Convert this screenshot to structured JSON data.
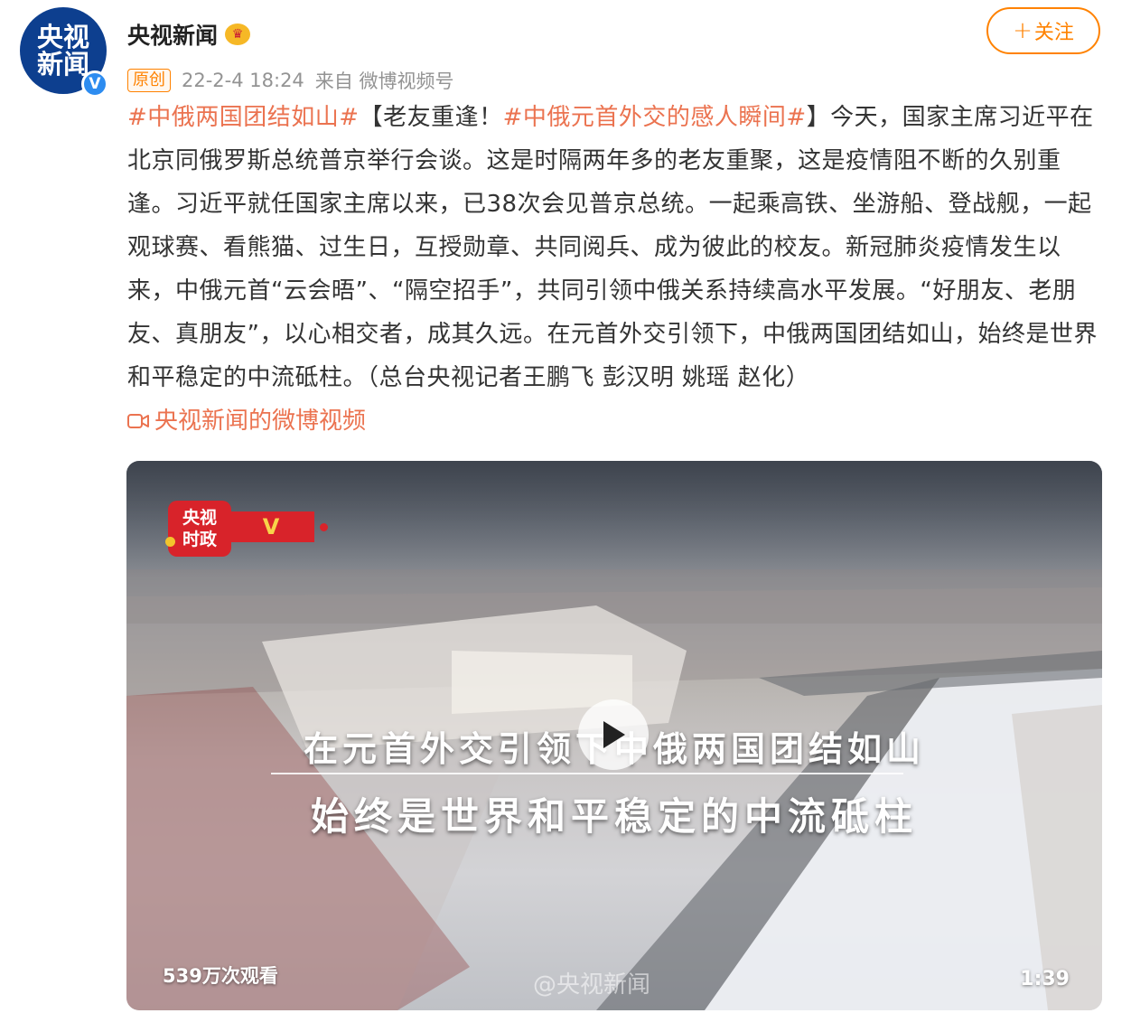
{
  "account": {
    "name": "央视新闻",
    "avatar_line1": "央视",
    "avatar_line2": "新闻",
    "verified_mark": "V",
    "follow_label": "关注",
    "follow_plus": "+"
  },
  "post": {
    "original_tag": "原创",
    "time": "22-2-4 18:24",
    "source": "来自 微博视频号",
    "hashtag1": "#中俄两国团结如山#",
    "bracket_text": "【老友重逢！",
    "hashtag2": "#中俄元首外交的感人瞬间#",
    "body": "】今天，国家主席习近平在北京同俄罗斯总统普京举行会谈。这是时隔两年多的老友重聚，这是疫情阻不断的久别重逢。习近平就任国家主席以来，已38次会见普京总统。一起乘高铁、坐游船、登战舰，一起观球赛、看熊猫、过生日，互授勋章、共同阅兵、成为彼此的校友。新冠肺炎疫情发生以来，中俄元首“云会晤”、“隔空招手”，共同引领中俄关系持续高水平发展。“好朋友、老朋友、真朋友”，以心相交者，成其久远。在元首外交引领下，中俄两国团结如山，始终是世界和平稳定的中流砥柱。（总台央视记者王鹏飞 彭汉明 姚瑶 赵化）",
    "video_link": "央视新闻的微博视频"
  },
  "video": {
    "logo_line1": "央视",
    "logo_line2": "时政",
    "logo_mark": "V",
    "caption_line1": "在元首外交引领下中俄两国团结如山",
    "caption_line2": "始终是世界和平稳定的中流砥柱",
    "views": "539万次观看",
    "duration": "1:39",
    "watermark": "@央视新闻"
  },
  "colors": {
    "accent": "#ff8200",
    "hashtag": "#eb7350",
    "verified": "#2d8cf0",
    "avatar_bg": "#0d3f8f",
    "badge_red": "#d8232a"
  },
  "icons": [
    "crown-icon",
    "verified-icon",
    "plus-icon",
    "video-camera-icon",
    "play-icon"
  ]
}
